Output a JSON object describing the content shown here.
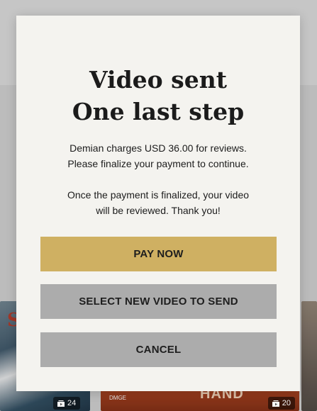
{
  "modal": {
    "title_line1": "Video sent",
    "title_line2": "One last step",
    "message_line1": "Demian charges USD 36.00 for reviews.",
    "message_line2": "Please finalize your payment to continue.",
    "message_line3": "Once the payment is finalized, your video",
    "message_line4": "will be reviewed. Thank you!",
    "pay_button": "PAY NOW",
    "select_button": "SELECT NEW VIDEO TO SEND",
    "cancel_button": "CANCEL"
  },
  "background": {
    "thumbnails": [
      {
        "letter": "S",
        "count": "24"
      },
      {
        "label": "DMGE",
        "overlay": "HAND",
        "count": "20"
      }
    ]
  },
  "colors": {
    "modal_bg": "#f4f3ef",
    "pay_accent": "#cfb062",
    "secondary_button": "#acacac"
  }
}
